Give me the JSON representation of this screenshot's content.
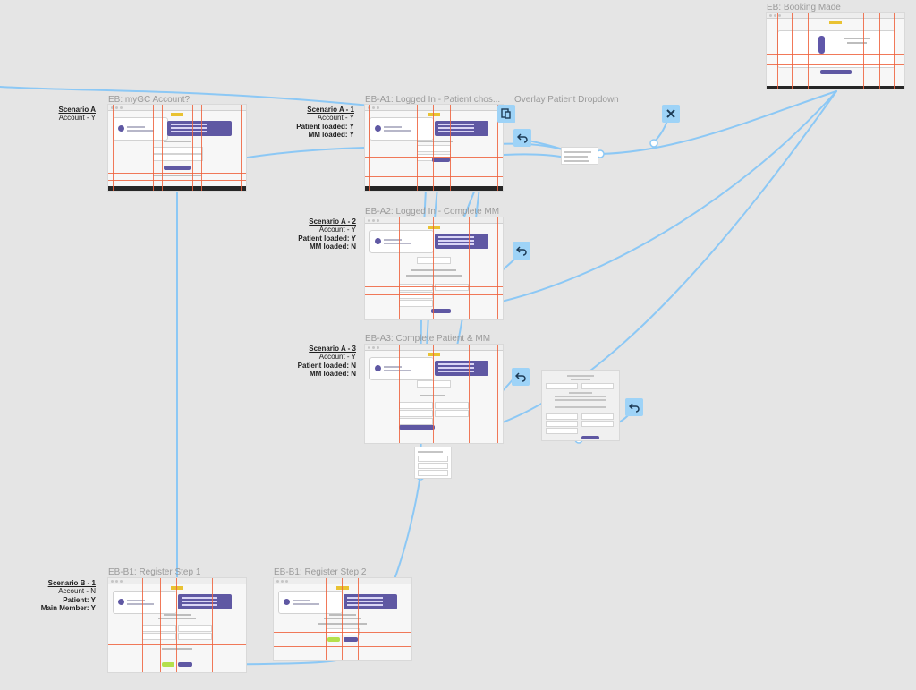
{
  "frames": {
    "booking_made": "EB: Booking Made",
    "mygc_account": "EB: myGC Account?",
    "logged_in_patient": "EB-A1: Logged In - Patient chos...",
    "overlay_patient": "Overlay Patient Dropdown",
    "logged_in_complete_mm": "EB-A2: Logged In - Complete MM",
    "complete_patient_mm": "EB-A3: Complete Patient & MM",
    "register_step_1": "EB-B1: Register Step 1",
    "register_step_2": "EB-B1: Register Step 2"
  },
  "scenarios": {
    "a": {
      "heading": "Scenario A",
      "lines": [
        "Account - Y"
      ]
    },
    "a1": {
      "heading": "Scenario A - 1",
      "lines": [
        "Account - Y",
        "Patient loaded: Y",
        "MM loaded: Y"
      ]
    },
    "a2": {
      "heading": "Scenario A - 2",
      "lines": [
        "Account - Y",
        "Patient loaded: Y",
        "MM loaded: N"
      ]
    },
    "a3": {
      "heading": "Scenario A - 3",
      "lines": [
        "Account - Y",
        "Patient loaded: N",
        "MM loaded: N"
      ]
    },
    "b1": {
      "heading": "Scenario B - 1",
      "lines": [
        "Account - N",
        "Patient: Y",
        "Main Member: Y"
      ]
    }
  },
  "hotspots": {
    "overlay": "overlay-icon",
    "close": "close-icon",
    "back": "back-arrow-icon"
  },
  "colors": {
    "canvas": "#e5e5e5",
    "connector": "#8cc8f5",
    "guide": "#ee623c",
    "accent": "#5f58a3",
    "hotspot": "#9ed3f7",
    "cta_green": "#b4e04c"
  }
}
